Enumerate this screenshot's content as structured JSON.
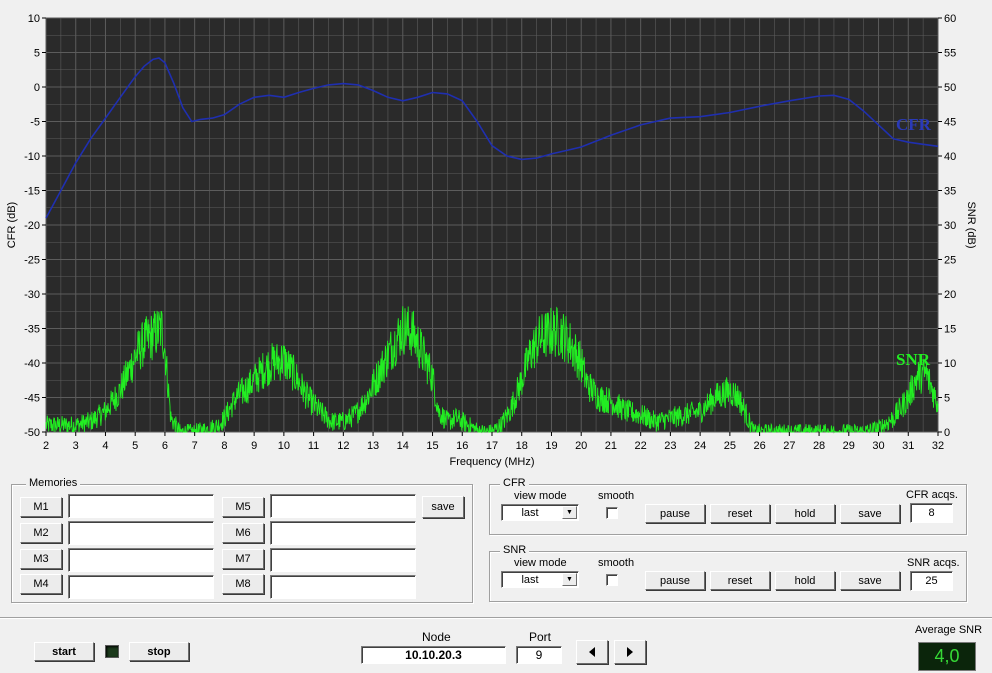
{
  "chart_data": {
    "type": "line",
    "xlabel": "Frequency (MHz)",
    "ylabel_left": "CFR (dB)",
    "ylabel_right": "SNR (dB)",
    "xlim": [
      2,
      32
    ],
    "ylim_left": [
      -50,
      10
    ],
    "ylim_right": [
      0,
      60
    ],
    "x_ticks": [
      "2",
      "3",
      "4",
      "5",
      "6",
      "7",
      "8",
      "9",
      "10",
      "11",
      "12",
      "13",
      "14",
      "15",
      "16",
      "17",
      "18",
      "19",
      "20",
      "21",
      "22",
      "23",
      "24",
      "25",
      "26",
      "27",
      "28",
      "29",
      "30",
      "31",
      "32"
    ],
    "y_left_ticks": [
      "10",
      "5",
      "0",
      "-5",
      "-10",
      "-15",
      "-20",
      "-25",
      "-30",
      "-35",
      "-40",
      "-45",
      "-50"
    ],
    "y_right_ticks": [
      "60",
      "55",
      "50",
      "45",
      "40",
      "35",
      "30",
      "25",
      "20",
      "15",
      "10",
      "5",
      "0"
    ],
    "grid": true,
    "series": [
      {
        "name": "CFR",
        "axis": "left",
        "color": "#1f2fb0",
        "x": [
          2,
          2.5,
          3,
          3.5,
          4,
          4.5,
          5,
          5.3,
          5.6,
          5.8,
          6,
          6.3,
          6.6,
          6.9,
          7.2,
          7.6,
          8,
          8.5,
          9,
          9.5,
          10,
          10.5,
          11,
          11.5,
          12,
          12.5,
          13,
          13.5,
          14,
          14.5,
          15,
          15.5,
          16,
          16.5,
          17,
          17.5,
          18,
          18.5,
          19,
          19.5,
          20,
          21,
          22,
          23,
          24,
          25,
          26,
          27,
          28,
          28.5,
          29,
          29.5,
          30,
          30.5,
          31,
          31.5,
          32
        ],
        "values": [
          -19,
          -15,
          -11,
          -7.5,
          -4.5,
          -1.5,
          1.5,
          3,
          4,
          4.2,
          3.5,
          0.5,
          -3,
          -5,
          -4.7,
          -4.5,
          -4,
          -2.5,
          -1.5,
          -1.2,
          -1.5,
          -0.8,
          -0.2,
          0.3,
          0.5,
          0.3,
          -0.5,
          -1.5,
          -2,
          -1.5,
          -0.8,
          -1,
          -2,
          -5,
          -8.5,
          -10,
          -10.5,
          -10.3,
          -9.7,
          -9.2,
          -8.7,
          -7,
          -5.5,
          -4.5,
          -4.3,
          -3.7,
          -2.8,
          -2,
          -1.3,
          -1.2,
          -1.8,
          -3.5,
          -5.5,
          -7.5,
          -8,
          -8.3,
          -8.6
        ]
      },
      {
        "name": "SNR",
        "axis": "right",
        "color": "#22ee22",
        "x": [
          2,
          2.5,
          3,
          3.5,
          4,
          4.5,
          5,
          5.3,
          5.6,
          5.9,
          6,
          6.2,
          6.5,
          7,
          7.5,
          7.8,
          8,
          8.4,
          8.8,
          9,
          9.3,
          9.6,
          10,
          10.4,
          10.8,
          11.2,
          11.6,
          12,
          12.4,
          12.8,
          13.2,
          13.6,
          14,
          14.3,
          14.6,
          15,
          15.2,
          15.5,
          15.8,
          16.2,
          16.6,
          16.8,
          17,
          17.3,
          17.6,
          18,
          18.3,
          18.6,
          19,
          19.3,
          19.6,
          20,
          20.2,
          20.6,
          21,
          21.5,
          22,
          22.5,
          23,
          23.5,
          24,
          24.5,
          25,
          25.3,
          25.6,
          25.8,
          26,
          26.5,
          27,
          27.5,
          28,
          28.5,
          29,
          29.5,
          30,
          30.5,
          31,
          31.3,
          31.6,
          32
        ],
        "values": [
          1,
          1,
          1,
          1.5,
          3,
          6,
          11,
          13,
          14,
          15,
          12,
          2,
          0,
          0,
          0.5,
          1,
          2,
          5,
          6.5,
          7.5,
          9,
          10,
          10.5,
          8,
          5,
          3,
          1.5,
          1.5,
          2.5,
          5,
          8.5,
          12,
          15,
          14.5,
          12,
          8,
          3,
          1.5,
          2,
          1,
          0,
          0,
          0,
          1,
          3,
          7.5,
          11.5,
          13.5,
          14.5,
          14.5,
          13,
          10,
          7,
          5,
          4.5,
          3,
          2.5,
          1.5,
          2,
          2.5,
          3,
          5,
          6,
          5,
          2,
          0,
          0,
          0,
          0,
          0,
          0,
          0,
          0,
          0,
          0.5,
          2,
          5,
          8,
          8.5,
          4
        ]
      }
    ],
    "annotations": [
      "CFR",
      "SNR"
    ]
  },
  "memories": {
    "title": "Memories",
    "left": [
      {
        "label": "M1",
        "value": ""
      },
      {
        "label": "M2",
        "value": ""
      },
      {
        "label": "M3",
        "value": ""
      },
      {
        "label": "M4",
        "value": ""
      }
    ],
    "right": [
      {
        "label": "M5",
        "value": ""
      },
      {
        "label": "M6",
        "value": ""
      },
      {
        "label": "M7",
        "value": ""
      },
      {
        "label": "M8",
        "value": ""
      }
    ],
    "save_label": "save"
  },
  "cfr_panel": {
    "title": "CFR",
    "view_mode_label": "view mode",
    "view_mode_value": "last",
    "smooth_label": "smooth",
    "pause_label": "pause",
    "reset_label": "reset",
    "hold_label": "hold",
    "save_label": "save",
    "acqs_label": "CFR acqs.",
    "acqs_value": "8"
  },
  "snr_panel": {
    "title": "SNR",
    "view_mode_label": "view mode",
    "view_mode_value": "last",
    "smooth_label": "smooth",
    "pause_label": "pause",
    "reset_label": "reset",
    "hold_label": "hold",
    "save_label": "save",
    "acqs_label": "SNR acqs.",
    "acqs_value": "25"
  },
  "bottom": {
    "start_label": "start",
    "stop_label": "stop",
    "node_label": "Node",
    "node_value": "10.10.20.3",
    "port_label": "Port",
    "port_value": "9",
    "avg_snr_label": "Average SNR",
    "avg_snr_value": "4,0"
  },
  "colors": {
    "plot_bg": "#2a2a2a",
    "grid": "#5c5c5c",
    "cfr": "#1f2fb0",
    "snr": "#22ee22",
    "display_bg": "#0b250b",
    "display_fg": "#36d936"
  },
  "icons": {
    "prev": "triangle-left",
    "next": "triangle-right",
    "dropdown": "triangle-down"
  }
}
